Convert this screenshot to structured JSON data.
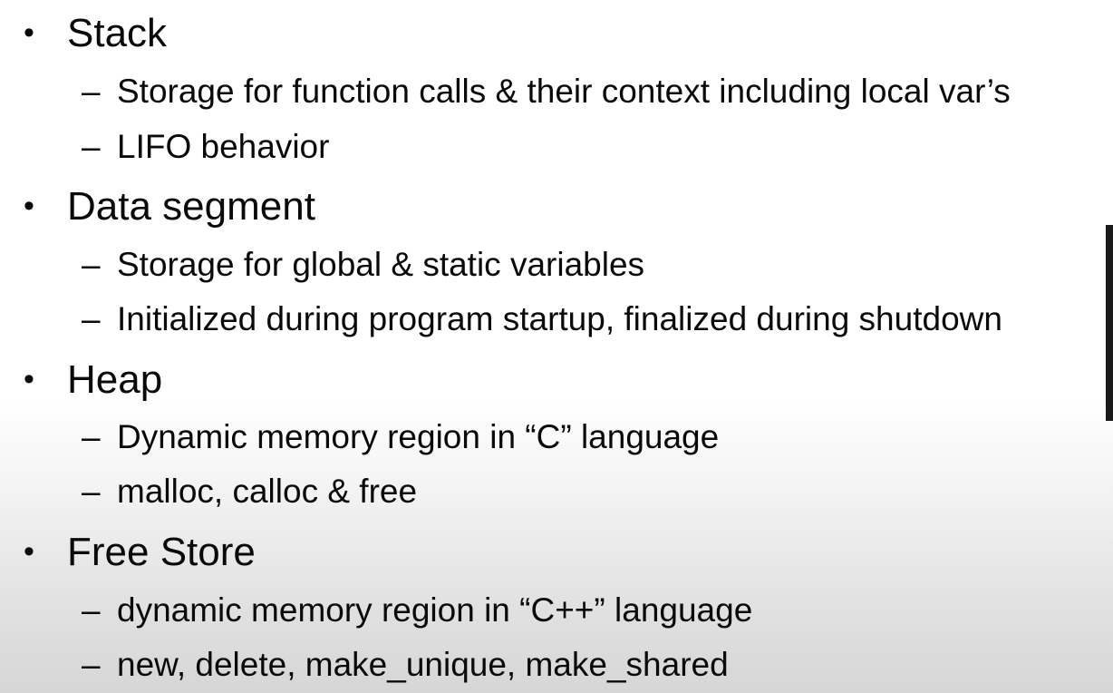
{
  "slide": {
    "bullet_marker": "•",
    "sub_marker": "–",
    "sections": [
      {
        "heading": "Stack",
        "items": [
          "Storage for function calls & their context including local var’s",
          "LIFO behavior"
        ]
      },
      {
        "heading": "Data segment",
        "items": [
          "Storage for global & static variables",
          "Initialized during program startup, finalized during shutdown"
        ]
      },
      {
        "heading": "Heap",
        "items": [
          "Dynamic memory region in “C” language",
          "malloc, calloc & free"
        ]
      },
      {
        "heading": "Free Store",
        "items": [
          "dynamic memory region in “C++” language",
          "new, delete, make_unique, make_shared"
        ]
      }
    ]
  }
}
